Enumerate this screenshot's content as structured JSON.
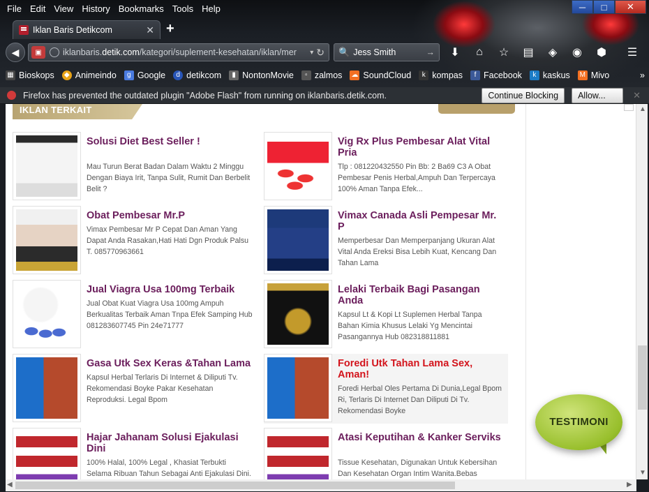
{
  "menubar": {
    "items": [
      "File",
      "Edit",
      "View",
      "History",
      "Bookmarks",
      "Tools",
      "Help"
    ]
  },
  "tab": {
    "title": "Iklan Baris Detikcom"
  },
  "navbar": {
    "url_prefix": "iklanbaris.",
    "url_domain": "detik.com",
    "url_path": "/kategori/suplement-kesehatan/iklan/mer",
    "search_value": "Jess Smith"
  },
  "bookmarks": [
    {
      "label": "Bioskops",
      "icon": "film-icon",
      "color": "#444"
    },
    {
      "label": "Animeindo",
      "icon": "anime-icon",
      "color": "#e8a317"
    },
    {
      "label": "Google",
      "icon": "google-icon",
      "color": "#4a7be0"
    },
    {
      "label": "detikcom",
      "icon": "detik-icon",
      "color": "#2855b8"
    },
    {
      "label": "NontonMovie",
      "icon": "movie-icon",
      "color": "#666"
    },
    {
      "label": "zalmos",
      "icon": "page-icon",
      "color": "#555"
    },
    {
      "label": "SoundCloud",
      "icon": "soundcloud-icon",
      "color": "#f26f23"
    },
    {
      "label": "kompas",
      "icon": "kompas-icon",
      "color": "#333"
    },
    {
      "label": "Facebook",
      "icon": "facebook-icon",
      "color": "#3b5998"
    },
    {
      "label": "kaskus",
      "icon": "kaskus-icon",
      "color": "#1b7cc6"
    },
    {
      "label": "Mivo",
      "icon": "mivo-icon",
      "color": "#f37021"
    }
  ],
  "notification": {
    "text": "Firefox has prevented the outdated plugin \"Adobe Flash\" from running on iklanbaris.detik.com.",
    "continue_label": "Continue Blocking",
    "allow_label": "Allow..."
  },
  "section": {
    "header": "IKLAN TERKAIT"
  },
  "ads": [
    {
      "title": "Solusi Diet Best Seller !",
      "desc": "Mau Turun Berat Badan Dalam Waktu 2 Minggu Dengan Biaya Irit, Tanpa Sulit, Rumit Dan Berbelit Belit ?",
      "img": "diet"
    },
    {
      "title": "Vig Rx Plus Pembesar Alat Vital Pria",
      "desc": "Tlp : 081220432550 Pin Bb: 2 Ba69 C3 A Obat Pembesar Penis Herbal,Ampuh Dan Terpercaya 100% Aman Tanpa Efek...",
      "img": "vig"
    },
    {
      "title": "Obat Pembesar Mr.P",
      "desc": "Vimax Pembesar Mr P Cepat Dan Aman Yang Dapat Anda Rasakan,Hati Hati Dgn Produk Palsu T. 085770963661",
      "img": "obat"
    },
    {
      "title": "Vimax Canada Asli Pempesar Mr. P",
      "desc": "Memperbesar Dan Memperpanjang Ukuran Alat Vital Anda Ereksi Bisa Lebih Kuat, Kencang Dan Tahan Lama",
      "img": "vimax"
    },
    {
      "title": "Jual Viagra Usa 100mg Terbaik",
      "desc": "Jual Obat Kuat Viagra Usa 100mg Ampuh Berkualitas Terbaik Aman Tnpa Efek Samping Hub 081283607745 Pin 24e71777",
      "img": "viagra"
    },
    {
      "title": "Lelaki Terbaik Bagi Pasangan Anda",
      "desc": "Kapsul Lt & Kopi Lt Suplemen Herbal Tanpa Bahan Kimia Khusus Lelaki Yg Mencintai Pasangannya Hub 082318811881",
      "img": "lt"
    },
    {
      "title": "Gasa Utk Sex Keras &Tahan Lama",
      "desc": "Kapsul Herbal Terlaris Di Internet & Diliputi Tv. Rekomendasi Boyke Pakar Kesehatan Reproduksi. Legal Bpom",
      "img": "boyke"
    },
    {
      "title": "Foredi Utk Tahan Lama Sex, Aman!",
      "desc": "Foredi Herbal Oles Pertama Di Dunia,Legal Bpom Ri, Terlaris Di Internet Dan Diliputi Di Tv. Rekomendasi Boyke",
      "img": "boyke"
    },
    {
      "title": "Hajar Jahanam Solusi Ejakulasi Dini",
      "desc": "100% Halal, 100% Legal , Khasiat Terbukti Selama Ribuan Tahun Sebagai Anti Ejakulasi Dini.",
      "img": "bars"
    },
    {
      "title": "Atasi Keputihan & Kanker Serviks",
      "desc": "Tissue Kesehatan, Digunakan Untuk Kebersihan Dan Kesehatan Organ Intim Wanita.Bebas",
      "img": "bars"
    }
  ],
  "testimoni": {
    "label": "TESTIMONI"
  }
}
